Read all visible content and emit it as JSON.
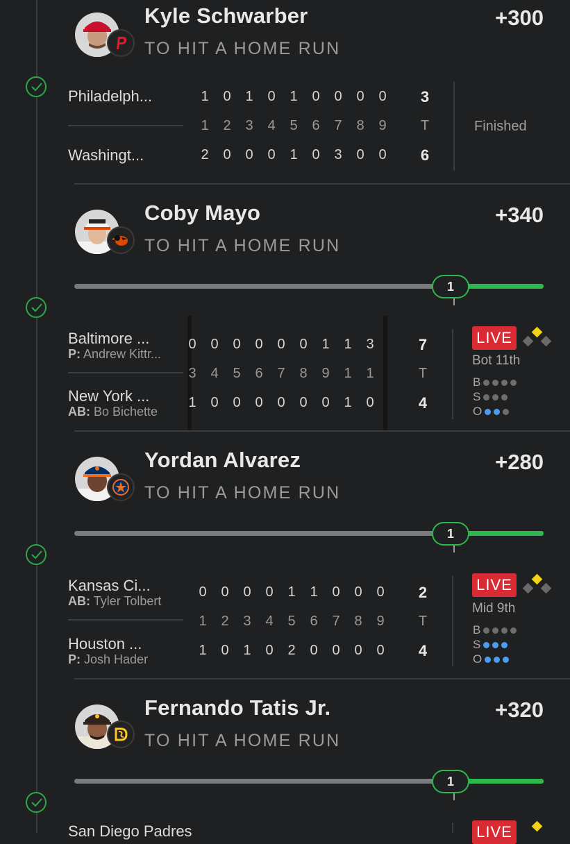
{
  "colors": {
    "accent_green": "#2db84e",
    "live_red": "#d92b34",
    "out_blue": "#4a9df0",
    "base_yellow": "#f5d21a"
  },
  "bets": [
    {
      "player": "Kyle Schwarber",
      "bet_type": "TO HIT A HOME RUN",
      "odds": "+300",
      "team_icon": "phillies-logo-icon",
      "game": {
        "away": {
          "name": "Philadelph...",
          "innings": [
            "1",
            "0",
            "1",
            "0",
            "1",
            "0",
            "0",
            "0",
            "0"
          ],
          "total": "3"
        },
        "home": {
          "name": "Washingt...",
          "innings": [
            "2",
            "0",
            "0",
            "0",
            "1",
            "0",
            "3",
            "0",
            "0"
          ],
          "total": "6"
        },
        "inning_labels": [
          "1",
          "2",
          "3",
          "4",
          "5",
          "6",
          "7",
          "8",
          "9"
        ],
        "total_label": "T",
        "status": "Finished"
      }
    },
    {
      "player": "Coby Mayo",
      "bet_type": "TO HIT A HOME RUN",
      "odds": "+340",
      "team_icon": "orioles-logo-icon",
      "progress": {
        "value": 1,
        "label": "1",
        "fraction": 0.8
      },
      "game": {
        "away": {
          "name": "Baltimore ...",
          "detail_prefix": "P:",
          "detail": "Andrew Kittr...",
          "innings": [
            "0",
            "0",
            "0",
            "0",
            "0",
            "0",
            "1",
            "1",
            "3"
          ],
          "total": "7"
        },
        "home": {
          "name": "New York ...",
          "detail_prefix": "AB:",
          "detail": "Bo Bichette",
          "innings": [
            "1",
            "0",
            "0",
            "0",
            "0",
            "0",
            "0",
            "1",
            "0"
          ],
          "total": "4"
        },
        "inning_labels": [
          "3",
          "4",
          "5",
          "6",
          "7",
          "8",
          "9",
          "1",
          "1"
        ],
        "total_label": "T",
        "live_label": "LIVE",
        "inning_state": "Bot 11th",
        "count": {
          "balls_label": "B",
          "strikes_label": "S",
          "outs_label": "O",
          "balls": 0,
          "strikes": 0,
          "outs": 2
        }
      }
    },
    {
      "player": "Yordan Alvarez",
      "bet_type": "TO HIT A HOME RUN",
      "odds": "+280",
      "team_icon": "astros-logo-icon",
      "progress": {
        "value": 1,
        "label": "1",
        "fraction": 0.8
      },
      "game": {
        "away": {
          "name": "Kansas Ci...",
          "detail_prefix": "AB:",
          "detail": "Tyler Tolbert",
          "innings": [
            "0",
            "0",
            "0",
            "0",
            "1",
            "1",
            "0",
            "0",
            "0"
          ],
          "total": "2"
        },
        "home": {
          "name": "Houston ...",
          "detail_prefix": "P:",
          "detail": "Josh Hader",
          "innings": [
            "1",
            "0",
            "1",
            "0",
            "2",
            "0",
            "0",
            "0",
            "0"
          ],
          "total": "4"
        },
        "inning_labels": [
          "1",
          "2",
          "3",
          "4",
          "5",
          "6",
          "7",
          "8",
          "9"
        ],
        "total_label": "T",
        "live_label": "LIVE",
        "inning_state": "Mid 9th",
        "count": {
          "balls_label": "B",
          "strikes_label": "S",
          "outs_label": "O",
          "balls": 0,
          "strikes": 3,
          "outs": 3
        }
      }
    },
    {
      "player": "Fernando Tatis Jr.",
      "bet_type": "TO HIT A HOME RUN",
      "odds": "+320",
      "team_icon": "padres-logo-icon",
      "progress": {
        "value": 1,
        "label": "1",
        "fraction": 0.8
      },
      "game": {
        "away": {
          "name": "San Diego Padres"
        },
        "live_label": "LIVE"
      }
    }
  ]
}
